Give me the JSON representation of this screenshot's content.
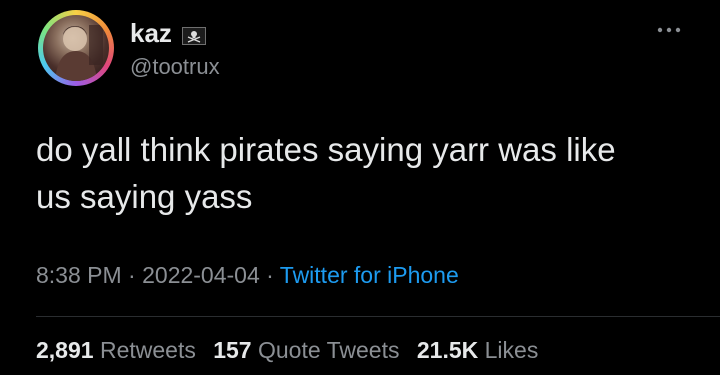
{
  "author": {
    "display_name": "kaz",
    "handle": "@tootrux",
    "flag_icon": "pirate-flag-icon"
  },
  "tweet": {
    "text": "do yall think pirates saying yarr was like\nus saying yass"
  },
  "meta": {
    "time": "8:38 PM",
    "separator": " · ",
    "date": "2022-04-04",
    "source": "Twitter for iPhone"
  },
  "stats": {
    "retweets_count": "2,891",
    "retweets_label": "Retweets",
    "quotes_count": "157",
    "quotes_label": "Quote Tweets",
    "likes_count": "21.5K",
    "likes_label": "Likes"
  },
  "colors": {
    "background": "#000000",
    "text": "#e7e9ea",
    "secondary": "#8b8f94",
    "link": "#1d9bf0"
  }
}
